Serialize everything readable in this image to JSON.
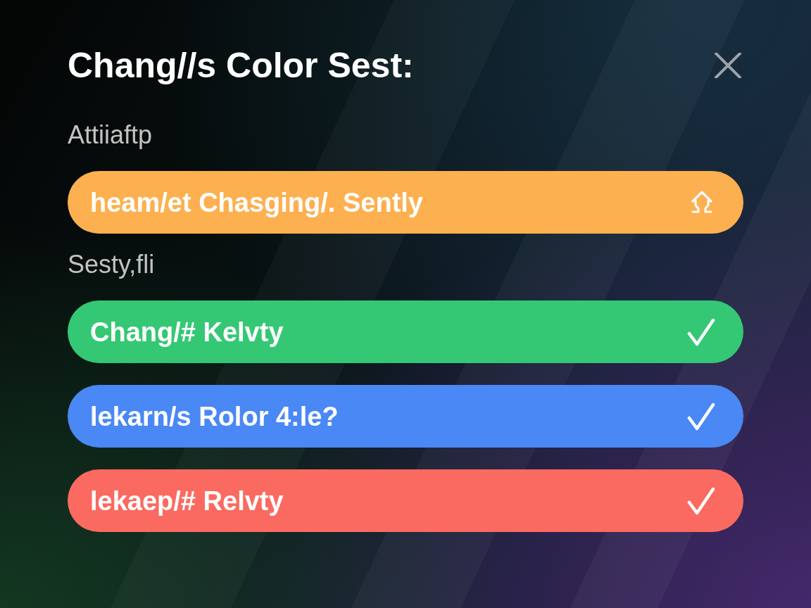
{
  "dialog": {
    "title": "Chang//s Color Sest:",
    "sections": [
      {
        "label": "Attiiaftp",
        "options": [
          {
            "label": "heam/et Chasging/. Sently",
            "color": "#fdb04f",
            "kind": "link"
          }
        ]
      },
      {
        "label": "Sesty,fli",
        "options": [
          {
            "label": "Chang/# Kelvty",
            "color": "#34c874",
            "kind": "toggle",
            "checked": true
          },
          {
            "label": "lekarn/s Rolor 4:le?",
            "color": "#4a88f5",
            "kind": "toggle",
            "checked": true
          },
          {
            "label": "lekaep/# Relvty",
            "color": "#fb6a60",
            "kind": "toggle",
            "checked": true
          }
        ]
      }
    ]
  }
}
